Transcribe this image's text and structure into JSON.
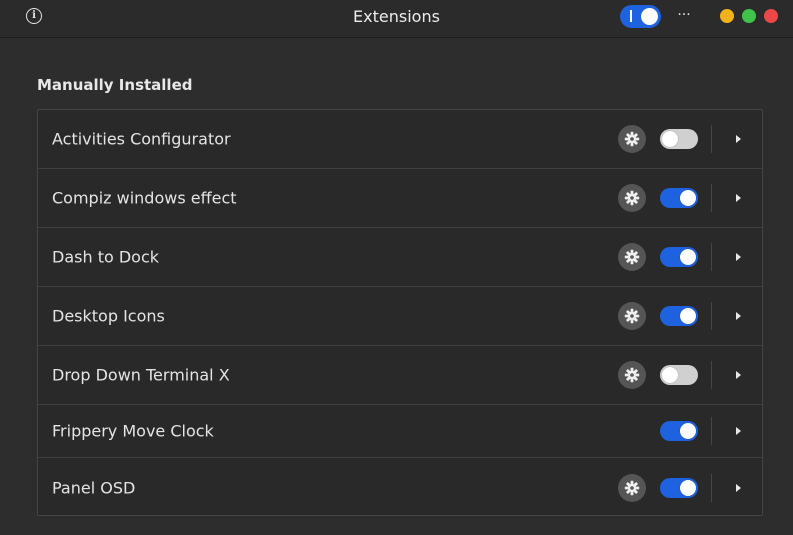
{
  "window": {
    "title": "Extensions",
    "info_icon": "info-icon",
    "info_glyph": "i",
    "menu_label": "···",
    "global_switch_on": true,
    "controls": [
      "minimize",
      "maximize",
      "close"
    ],
    "colors": {
      "accent": "#1e62e0",
      "minimize": "#f1b21c",
      "maximize": "#3fc34a",
      "close": "#ee4747"
    }
  },
  "section": {
    "title": "Manually Installed"
  },
  "extensions": [
    {
      "name": "Activities Configurator",
      "has_settings": true,
      "enabled": false
    },
    {
      "name": "Compiz windows effect",
      "has_settings": true,
      "enabled": true
    },
    {
      "name": "Dash to Dock",
      "has_settings": true,
      "enabled": true
    },
    {
      "name": "Desktop Icons",
      "has_settings": true,
      "enabled": true
    },
    {
      "name": "Drop Down Terminal X",
      "has_settings": true,
      "enabled": false
    },
    {
      "name": "Frippery Move Clock",
      "has_settings": false,
      "enabled": true
    },
    {
      "name": "Panel OSD",
      "has_settings": true,
      "enabled": true
    }
  ]
}
